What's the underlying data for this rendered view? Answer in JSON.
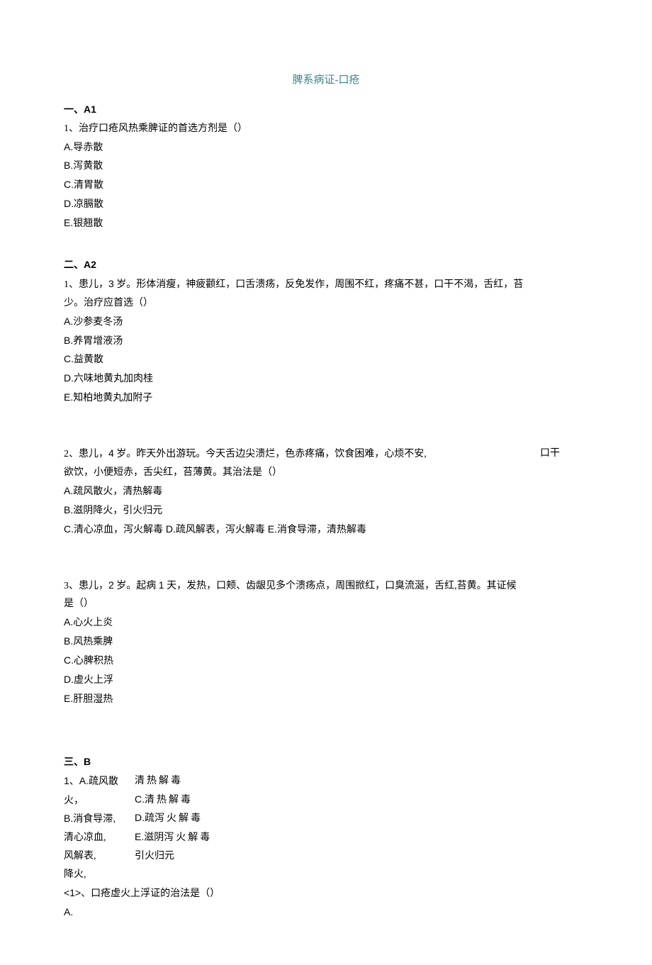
{
  "title": "脾系病证-口疮",
  "sec1": {
    "header_cn": "一、",
    "header_en": "A1",
    "q1": {
      "stem": "1、治疗口疮风热乘脾证的首选方剂是（）",
      "A": "A.导赤散",
      "B": "B.泻黄散",
      "C": "C.清胃散",
      "D": "D.凉膈散",
      "E": "E.银翘散"
    }
  },
  "sec2": {
    "header_cn": "二、",
    "header_en": "A2",
    "q1": {
      "l1a": "1、患儿，",
      "l1b": "3",
      "l1c": " 岁。形体消瘦，神疲颧红，口舌溃疡，反免发作，周围不红，疼痛不甚，口干不渴，舌红，苔",
      "l2": "少。治疗应首选（）",
      "A": "A.沙参麦冬汤",
      "B": "B.养胃增液汤",
      "C": "C.益黄散",
      "D": "D.六味地黄丸加肉桂",
      "E": "E.知柏地黄丸加附子"
    },
    "q2": {
      "l1a": "2、患儿，",
      "l1b": "4",
      "l1c": " 岁。昨天外出游玩。今天舌边尖溃烂，色赤疼痛，饮食困难，心烦不安,",
      "l1d": "口干",
      "l2": "欲饮，小便短赤，舌尖红，苔薄黄。其治法是（）",
      "A": "A.疏风散火，清热解毒",
      "B": "B.滋阴降火，引火归元",
      "CDE": "C.清心凉血，泻火解毒 D.疏风解表，泻火解毒 E.消食导滞，清热解毒"
    },
    "q3": {
      "l1a": "3、患儿，",
      "l1b": "2",
      "l1c": " 岁。起病 ",
      "l1d": "1",
      "l1e": " 天，发热，口颊、齿龈见多个溃疡点，周围掀红，口臭流涎，舌红,苔黄。其证候",
      "l2": "是（）",
      "A": "A.心火上炎",
      "B": "B.风热乘脾",
      "C": "C.心脾积热",
      "D": "D.虚火上浮",
      "E": "E.肝胆湿热"
    }
  },
  "sec3": {
    "header_cn": "三、",
    "header_en": "B",
    "leftA": "1、A.疏风散火，",
    "leftB": "B.消食导滞,",
    "leftC": "清心凉血,",
    "leftD": "风解表,",
    "leftE": "降火,",
    "rightA": "清热解毒",
    "rightB_pre": "C.",
    "rightB": "清热解毒",
    "rightC_pre": "D.疏",
    "rightC": "泻火解毒",
    "rightD_pre": "E.滋阴",
    "rightD": "泻火解毒",
    "rightE": "引火归元",
    "sub1": "<1>、口疮虚火上浮证的治法是（）",
    "subA": "A."
  }
}
